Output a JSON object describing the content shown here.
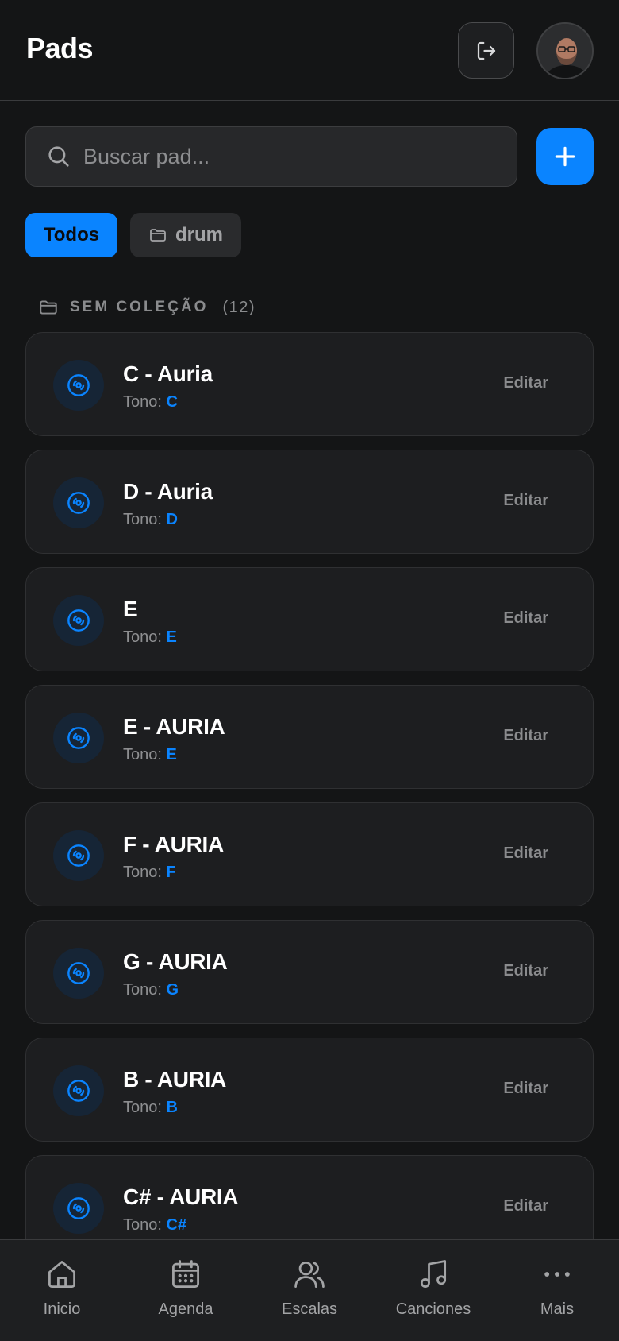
{
  "header": {
    "title": "Pads",
    "logout_icon": "logout-icon",
    "avatar_icon": "user-avatar"
  },
  "search": {
    "placeholder": "Buscar pad...",
    "value": "",
    "icon": "search-icon"
  },
  "add_button": {
    "icon": "plus-icon"
  },
  "filters": [
    {
      "label": "Todos",
      "active": true
    },
    {
      "label": "drum",
      "active": false,
      "icon": "folder-icon"
    }
  ],
  "section": {
    "title": "SEM COLEÇÃO",
    "count": "(12)",
    "icon": "folder-icon"
  },
  "pads": [
    {
      "name": "C - Auria",
      "tone_label": "Tono:",
      "tone": "C",
      "edit_label": "Editar"
    },
    {
      "name": "D - Auria",
      "tone_label": "Tono:",
      "tone": "D",
      "edit_label": "Editar"
    },
    {
      "name": "E",
      "tone_label": "Tono:",
      "tone": "E",
      "edit_label": "Editar"
    },
    {
      "name": "E - AURIA",
      "tone_label": "Tono:",
      "tone": "E",
      "edit_label": "Editar"
    },
    {
      "name": "F - AURIA",
      "tone_label": "Tono:",
      "tone": "F",
      "edit_label": "Editar"
    },
    {
      "name": "G - AURIA",
      "tone_label": "Tono:",
      "tone": "G",
      "edit_label": "Editar"
    },
    {
      "name": "B - AURIA",
      "tone_label": "Tono:",
      "tone": "B",
      "edit_label": "Editar"
    },
    {
      "name": "C# - AURIA",
      "tone_label": "Tono:",
      "tone": "C#",
      "edit_label": "Editar"
    }
  ],
  "bottom_nav": [
    {
      "label": "Inicio",
      "icon": "home-icon"
    },
    {
      "label": "Agenda",
      "icon": "calendar-icon"
    },
    {
      "label": "Escalas",
      "icon": "users-icon"
    },
    {
      "label": "Canciones",
      "icon": "music-note-icon"
    },
    {
      "label": "Mais",
      "icon": "more-icon"
    }
  ],
  "colors": {
    "background": "#141516",
    "accent": "#0a84ff",
    "card": "#1d1e20",
    "muted_text": "#8d8e90"
  }
}
